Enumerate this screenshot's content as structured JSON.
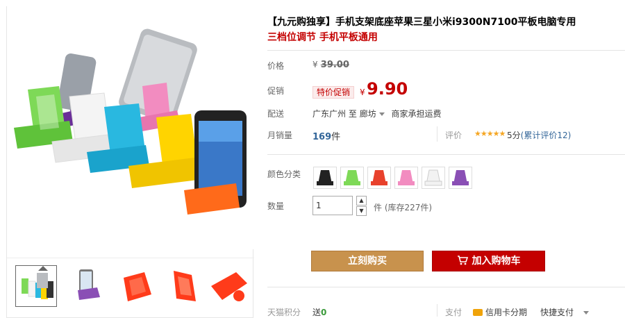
{
  "product": {
    "title": "【九元购独享】手机支架底座苹果三星小米i9300N7100平板电脑专用",
    "subtitle": "三档位调节  手机平板通用"
  },
  "price": {
    "label": "价格",
    "currency": "¥",
    "original": "39.00"
  },
  "promo": {
    "label": "促销",
    "badge": "特价促销",
    "currency": "¥",
    "price": "9.90"
  },
  "delivery": {
    "label": "配送",
    "from": "广东广州",
    "to_word": "至",
    "to": "廊坊",
    "fee": "商家承担运费"
  },
  "sales": {
    "label": "月销量",
    "count": "169",
    "unit": "件"
  },
  "reviews": {
    "label": "评价",
    "stars": "★★★★★",
    "score": "5分",
    "count_text": "(累计评价12)"
  },
  "colors": {
    "label": "颜色分类",
    "options": [
      {
        "name": "black",
        "hex": "#222222"
      },
      {
        "name": "green",
        "hex": "#7ed957"
      },
      {
        "name": "red",
        "hex": "#e8412c"
      },
      {
        "name": "pink",
        "hex": "#f28cc0"
      },
      {
        "name": "white",
        "hex": "#f2f2f2"
      },
      {
        "name": "purple",
        "hex": "#8a4fb5"
      }
    ]
  },
  "quantity": {
    "label": "数量",
    "value": "1",
    "unit": "件",
    "stock": "(库存227件)"
  },
  "actions": {
    "buy_now": "立刻购买",
    "add_to_cart": "加入购物车"
  },
  "footer": {
    "points_label": "天猫积分",
    "points_prefix": "送",
    "points_value": "0",
    "pay_label": "支付",
    "card": "信用卡分期",
    "quick": "快捷支付"
  },
  "colors_theme": {
    "accent": "#c40000",
    "buy_button": "#c8924d",
    "link": "#336699"
  }
}
